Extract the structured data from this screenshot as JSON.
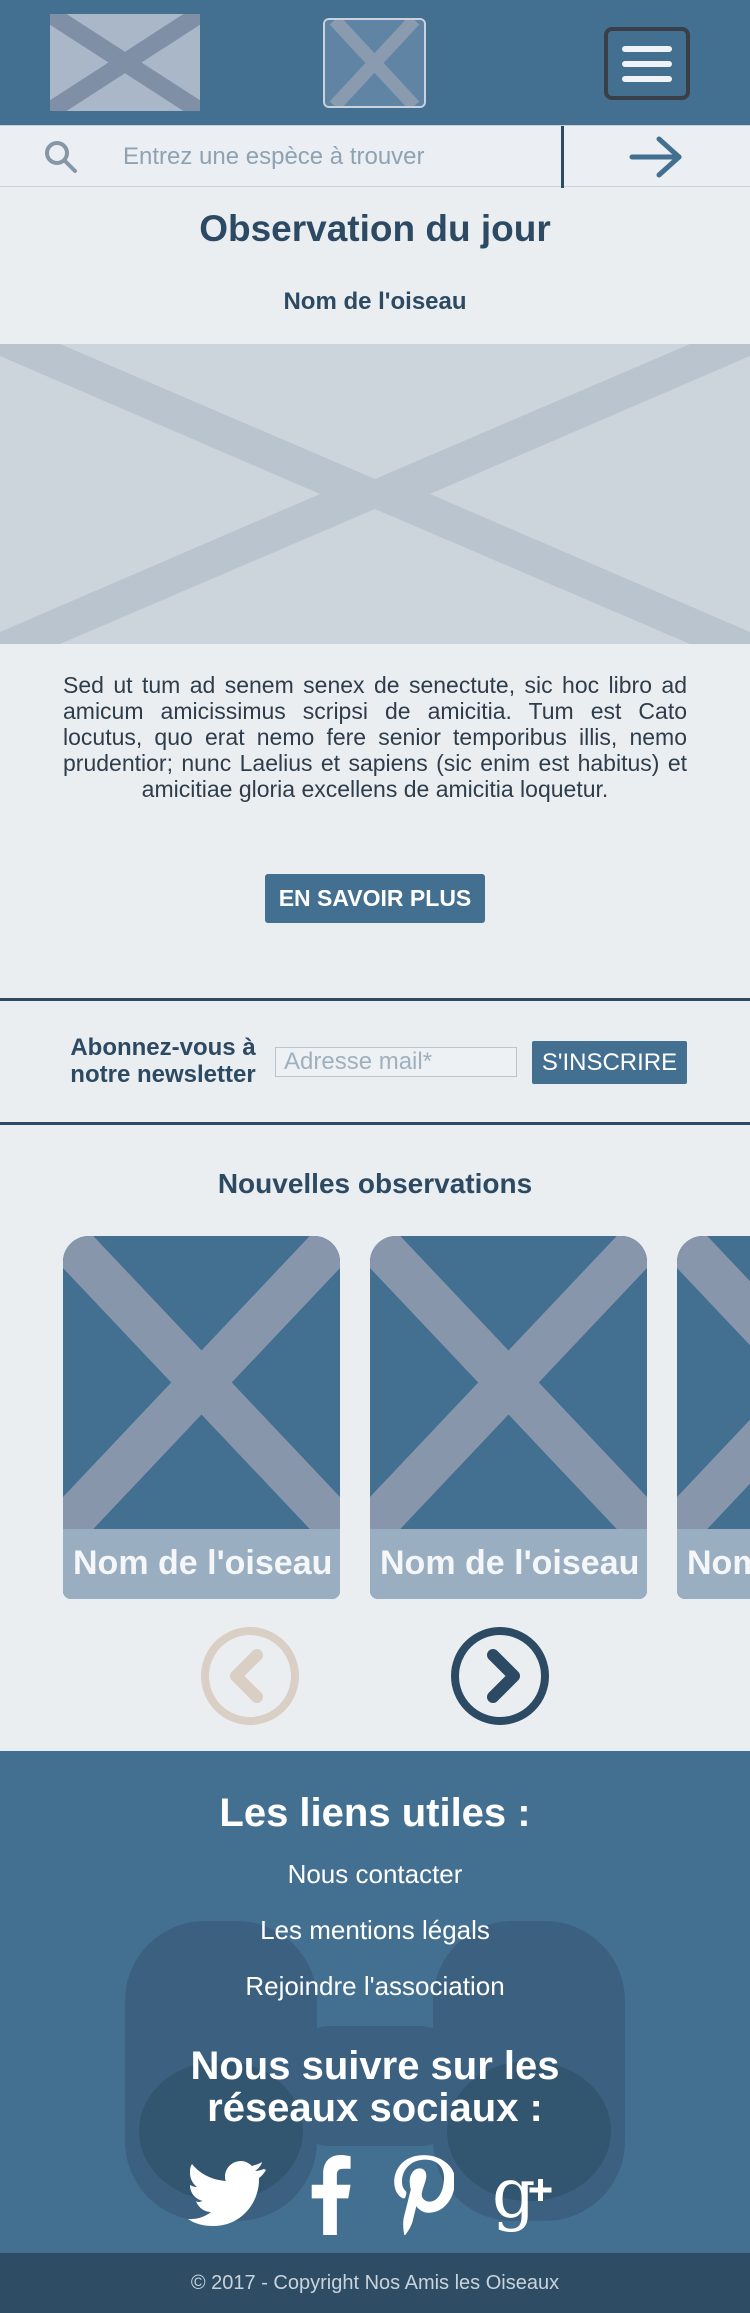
{
  "search": {
    "placeholder": "Entrez une espèce à trouver"
  },
  "observation": {
    "title": "Observation du jour",
    "bird_name": "Nom de l'oiseau",
    "text": "Sed ut tum ad senem senex de senectute, sic hoc libro ad amicum amicissimus scripsi de amicitia. Tum est Cato locutus, quo erat nemo fere senior temporibus illis, nemo prudentior; nunc Laelius et sapiens (sic enim est habitus) et amicitiae gloria excellens de amicitia loquetur.",
    "button": "EN SAVOIR PLUS"
  },
  "newsletter": {
    "label": "Abonnez-vous à notre newsletter",
    "placeholder": "Adresse mail*",
    "button": "S'INSCRIRE"
  },
  "new_observations": {
    "title": "Nouvelles observations",
    "cards": [
      {
        "label": "Nom de l'oiseau"
      },
      {
        "label": "Nom de l'oiseau"
      },
      {
        "label": "Nom de l'oiseau"
      }
    ]
  },
  "footer": {
    "links_title": "Les liens utiles :",
    "links": [
      "Nous contacter",
      "Les mentions légals",
      "Rejoindre l'association"
    ],
    "social_title": "Nous suivre sur les réseaux sociaux :",
    "social_icons": [
      "twitter-icon",
      "facebook-icon",
      "pinterest-icon",
      "google-plus-icon"
    ],
    "copyright": "© 2017 - Copyright Nos Amis les Oiseaux"
  },
  "colors": {
    "primary": "#436f91",
    "dark": "#2c4a63",
    "background": "#ebeef0",
    "prev_disabled": "#d9cfc4"
  }
}
